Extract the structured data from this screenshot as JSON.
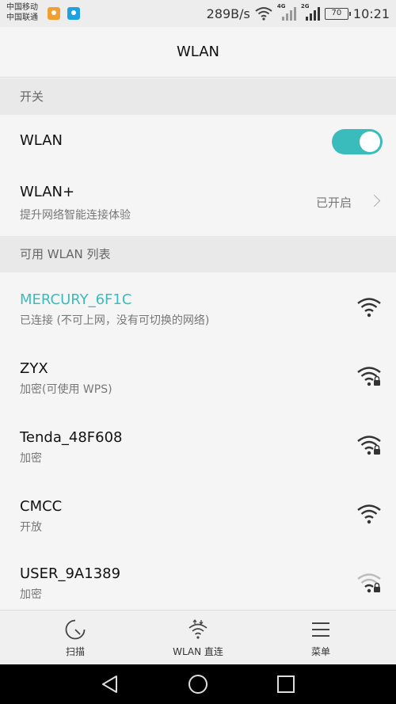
{
  "status_bar": {
    "carrier1": "中国移动",
    "carrier2": "中国联通",
    "net_speed": "289B/s",
    "sig1_type": "4G",
    "sig2_type": "2G",
    "battery": "70",
    "time": "10:21"
  },
  "title": "WLAN",
  "sections": {
    "switch_header": "开关",
    "available_header": "可用 WLAN 列表"
  },
  "wlan_toggle": {
    "label": "WLAN",
    "enabled": true
  },
  "wlan_plus": {
    "label": "WLAN+",
    "sub": "提升网络智能连接体验",
    "status": "已开启"
  },
  "networks": [
    {
      "ssid": "MERCURY_6F1C",
      "status": "已连接 (不可上网，没有可切换的网络)",
      "connected": true,
      "locked": false,
      "signal": 4
    },
    {
      "ssid": "ZYX",
      "status": "加密(可使用 WPS)",
      "connected": false,
      "locked": true,
      "signal": 4
    },
    {
      "ssid": "Tenda_48F608",
      "status": "加密",
      "connected": false,
      "locked": true,
      "signal": 4
    },
    {
      "ssid": "CMCC",
      "status": "开放",
      "connected": false,
      "locked": false,
      "signal": 4
    },
    {
      "ssid": "USER_9A1389",
      "status": "加密",
      "connected": false,
      "locked": true,
      "signal": 2
    }
  ],
  "toolbar": {
    "scan": "扫描",
    "direct": "WLAN 直连",
    "menu": "菜单"
  },
  "colors": {
    "accent": "#3bbcbc",
    "connected_text": "#3bbcbc"
  }
}
